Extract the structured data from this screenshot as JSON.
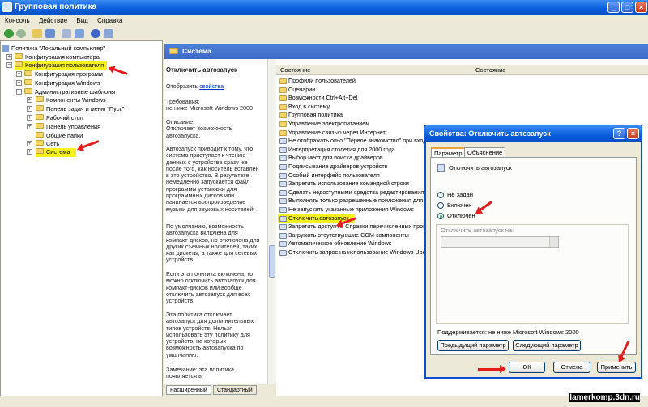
{
  "window": {
    "title": "Групповая политика"
  },
  "menu": [
    "Консоль",
    "Действие",
    "Вид",
    "Справка"
  ],
  "tree": [
    {
      "label": "Политика \"Локальный компьютер\""
    },
    {
      "label": "Конфигурация компьютера"
    },
    {
      "label": "Конфигурация пользователя"
    },
    {
      "label": "Конфигурация программ"
    },
    {
      "label": "Конфигурация Windows"
    },
    {
      "label": "Административные шаблоны"
    },
    {
      "label": "Компоненты Windows"
    },
    {
      "label": "Панель задач и меню \"Пуск\""
    },
    {
      "label": "Рабочий стол"
    },
    {
      "label": "Панель управления"
    },
    {
      "label": "Общие папки"
    },
    {
      "label": "Сеть"
    },
    {
      "label": "Система"
    }
  ],
  "header": {
    "title": "Система"
  },
  "description": {
    "title": "Отключить автозапуск",
    "show_prefix": "Отобразить",
    "show_link": "свойства",
    "requirements": "Требования:\nне ниже Microsoft Windows 2000",
    "p1": "Описание:\nОтключает возможность автозапуска.",
    "p2": "Автозапуск приводит к тому, что система приступает к чтению данных с устройства сразу же после того, как носитель вставлен в это устройство. В результате немедленно запускается файл программы установки для программных дисков или начинается воспроизведение музыки для звуковых носителей.",
    "p3": "По умолчанию, возможность автозапуска включена для компакт-дисков, но отключена для других съемных носителей, таких как дискеты, а также для сетевых устройств.",
    "p4": "Если эта политика включена, то можно отключить автозапуск для компакт-дисков или вообще отключить автозапуск для всех устройств.",
    "p5": "Эта политика отключает автозапуск для дополнительных типов устройств. Нельзя использовать эту политику для устройств, на которых возможность автозапуска по умолчанию.",
    "p6": "Замечание: эта политика появляется в"
  },
  "bottom_tabs": [
    "Расширенный",
    "Стандартный"
  ],
  "list": {
    "columns": [
      "Состояние",
      "Состояние"
    ],
    "items": [
      {
        "label": "Профили пользователей",
        "icon": "folder-icon"
      },
      {
        "label": "Сценарии",
        "icon": "folder-icon"
      },
      {
        "label": "Возможности Ctrl+Alt+Del",
        "icon": "folder-icon"
      },
      {
        "label": "Вход в систему",
        "icon": "folder-icon"
      },
      {
        "label": "Групповая политика",
        "icon": "folder-icon"
      },
      {
        "label": "Управление электропитанием",
        "icon": "folder-icon"
      },
      {
        "label": "Управление связью через Интернет",
        "icon": "folder-icon"
      },
      {
        "label": "Не отображать окно \"Первое знакомство\" при вход",
        "icon": "policy-icon"
      },
      {
        "label": "Интерпретация столетия для 2000 года",
        "icon": "policy-icon"
      },
      {
        "label": "Выбор мест для поиска драйверов",
        "icon": "policy-icon"
      },
      {
        "label": "Подписывание драйверов устройств",
        "icon": "policy-icon"
      },
      {
        "label": "Особый интерфейс пользователя",
        "icon": "policy-icon"
      },
      {
        "label": "Запретить использование командной строки",
        "icon": "policy-icon"
      },
      {
        "label": "Сделать недоступными средства редактирования",
        "icon": "policy-icon"
      },
      {
        "label": "Выполнять только разрешенные приложения для",
        "icon": "policy-icon"
      },
      {
        "label": "Не запускать указанные приложения Windows",
        "icon": "policy-icon"
      },
      {
        "label": "Отключить автозапуск",
        "icon": "policy-icon"
      },
      {
        "label": "Запретить доступ из Справки перечисленных прогр",
        "icon": "policy-icon"
      },
      {
        "label": "Загружать отсутствующие COM-компоненты",
        "icon": "policy-icon"
      },
      {
        "label": "Автоматическое обновление Windows",
        "icon": "policy-icon"
      },
      {
        "label": "Отключить запрос на использование Windows Upd",
        "icon": "policy-icon"
      }
    ]
  },
  "dialog": {
    "title": "Свойства: Отключить автозапуск",
    "tabs": [
      "Параметр",
      "Объяснение"
    ],
    "policy_name": "Отключить автозапуск",
    "options": [
      "Не задан",
      "Включен",
      "Отключен"
    ],
    "selected": "Отключен",
    "combo_label": "Отключить автозапуск на:",
    "supported_label": "Поддерживается:",
    "supported_value": "не ниже Microsoft Windows 2000",
    "prev_button": "Предыдущий параметр",
    "next_button": "Следующий параметр",
    "ok": "ОК",
    "cancel": "Отмена",
    "apply": "Применить"
  },
  "watermark": "lamerkomp.3dn.ru",
  "colors": {
    "accent": "#0a5ddc",
    "highlight": "#f7f01f",
    "arrow": "#e61b1b"
  }
}
